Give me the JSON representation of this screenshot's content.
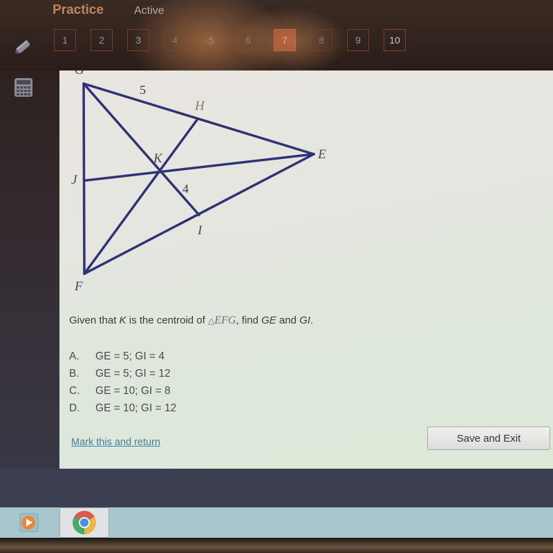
{
  "header": {
    "brand": "Practice",
    "status": "Active"
  },
  "question_nav": [
    {
      "label": "1",
      "state": "normal"
    },
    {
      "label": "2",
      "state": "normal"
    },
    {
      "label": "3",
      "state": "normal"
    },
    {
      "label": "4",
      "state": "faded"
    },
    {
      "label": "5",
      "state": "faded"
    },
    {
      "label": "6",
      "state": "faded"
    },
    {
      "label": "7",
      "state": "current"
    },
    {
      "label": "8",
      "state": "faded"
    },
    {
      "label": "9",
      "state": "normal"
    },
    {
      "label": "10",
      "state": "bright"
    }
  ],
  "tools": {
    "pencil": "pencil-icon",
    "calculator": "calculator-icon"
  },
  "figure": {
    "vertex_labels": {
      "G": "G",
      "H": "H",
      "E": "E",
      "J": "J",
      "K": "K",
      "I": "I",
      "F": "F"
    },
    "segment_labels": {
      "GH": "5",
      "KI": "4"
    }
  },
  "question": {
    "prefix": "Given that ",
    "K": "K",
    "middle": " is the centroid of ",
    "triangle_symbol": "△",
    "triangle_name": "EFG",
    "after_triangle": ", find ",
    "GE": "GE",
    "and": " and ",
    "GI": "GI",
    "end": "."
  },
  "choices": [
    {
      "letter": "A.",
      "text": "GE = 5; GI = 4"
    },
    {
      "letter": "B.",
      "text": "GE = 5; GI = 12"
    },
    {
      "letter": "C.",
      "text": "GE = 10; GI = 8"
    },
    {
      "letter": "D.",
      "text": "GE = 10; GI = 12"
    }
  ],
  "footer": {
    "mark_link": "Mark this and return",
    "save_button": "Save and Exit"
  },
  "colors": {
    "brand": "#c4835a",
    "line": "#2f3275",
    "link": "#3f7fa0"
  }
}
